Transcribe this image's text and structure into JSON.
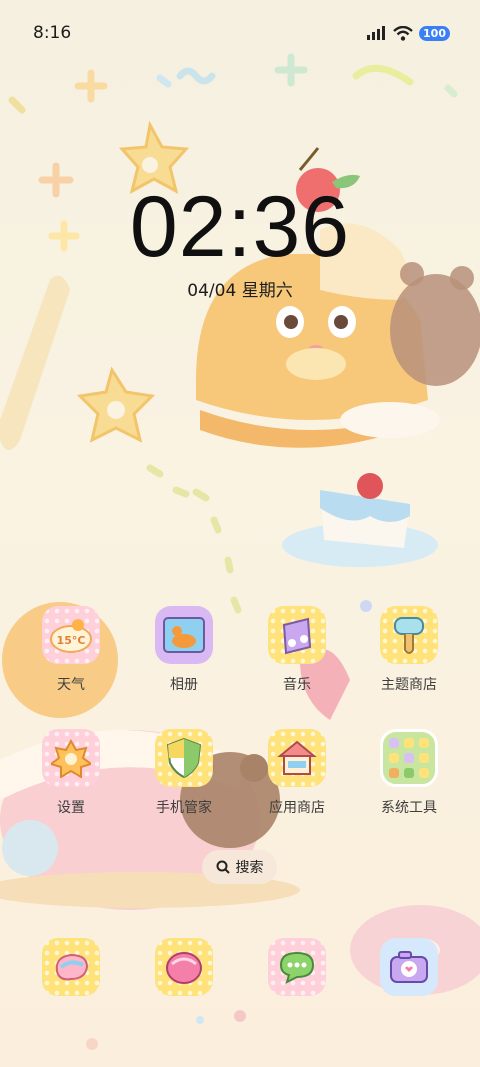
{
  "status_bar": {
    "time": "8:16",
    "battery": "100"
  },
  "clock": {
    "time": "02:36",
    "date": "04/04 星期六"
  },
  "weather_icon_text": "15°C",
  "apps": [
    {
      "label": "天气",
      "icon": "weather-icon"
    },
    {
      "label": "相册",
      "icon": "gallery-icon"
    },
    {
      "label": "音乐",
      "icon": "music-icon"
    },
    {
      "label": "主题商店",
      "icon": "theme-store-icon"
    },
    {
      "label": "设置",
      "icon": "settings-icon"
    },
    {
      "label": "手机管家",
      "icon": "phone-manager-icon"
    },
    {
      "label": "应用商店",
      "icon": "app-store-icon"
    },
    {
      "label": "系统工具",
      "icon": "system-tools-folder-icon"
    }
  ],
  "search": {
    "label": "搜索"
  },
  "dock": [
    {
      "icon": "phone-icon"
    },
    {
      "icon": "contacts-icon"
    },
    {
      "icon": "messages-icon"
    },
    {
      "icon": "camera-icon"
    }
  ],
  "colors": {
    "background": "#f7f1e1",
    "icon_yellow": "#ffe27a",
    "icon_pink": "#ffd0da",
    "battery": "#3a7ff6"
  }
}
